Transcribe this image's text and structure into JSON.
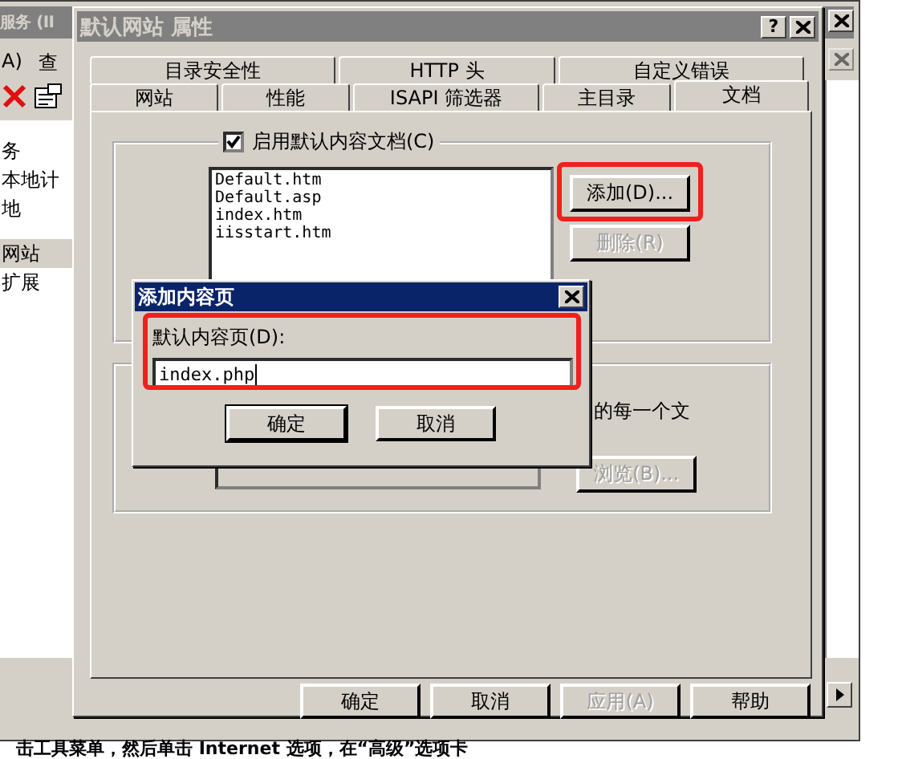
{
  "background_window": {
    "title": "服务 (II",
    "menu": [
      "A)",
      "查"
    ],
    "tree": [
      {
        "label": "务",
        "selected": false
      },
      {
        "label": "本地计",
        "selected": false
      },
      {
        "label": "地",
        "selected": false
      },
      {
        "label": "网站",
        "selected": true
      },
      {
        "label": "扩展",
        "selected": false
      }
    ]
  },
  "dialog": {
    "title": "默认网站 属性",
    "help": "?",
    "tab_rows": [
      [
        {
          "label": "目录安全性",
          "selected": false
        },
        {
          "label": "HTTP 头",
          "selected": false
        },
        {
          "label": "自定义错误",
          "selected": false
        }
      ],
      [
        {
          "label": "网站",
          "selected": false
        },
        {
          "label": "性能",
          "selected": false
        },
        {
          "label": "ISAPI 筛选器",
          "selected": false
        },
        {
          "label": "主目录",
          "selected": false
        },
        {
          "label": "文档",
          "selected": true
        }
      ]
    ],
    "enable_default": {
      "label": "启用默认内容文档(C)",
      "checked": true
    },
    "documents": [
      "Default.htm",
      "Default.asp",
      "index.htm",
      "iisstart.htm"
    ],
    "add_button": {
      "label": "添加(D)...",
      "disabled": false,
      "highlighted": true
    },
    "remove_button": {
      "label": "删除(R)",
      "disabled": true
    },
    "footer_text": "的每一个文",
    "browse_button": {
      "label": "浏览(B)...",
      "disabled": true
    },
    "buttons": [
      {
        "label": "确定",
        "disabled": false
      },
      {
        "label": "取消",
        "disabled": false
      },
      {
        "label": "应用(A)",
        "disabled": true
      },
      {
        "label": "帮助",
        "disabled": false
      }
    ]
  },
  "popup": {
    "title": "添加内容页",
    "label": "默认内容页(D):",
    "value": "index.php",
    "highlighted": true,
    "buttons": [
      {
        "label": "确定",
        "default": true
      },
      {
        "label": "取消",
        "default": false
      }
    ]
  },
  "page_text": "击工具菜单，然后单击 Internet 选项，在“高级”选项卡"
}
